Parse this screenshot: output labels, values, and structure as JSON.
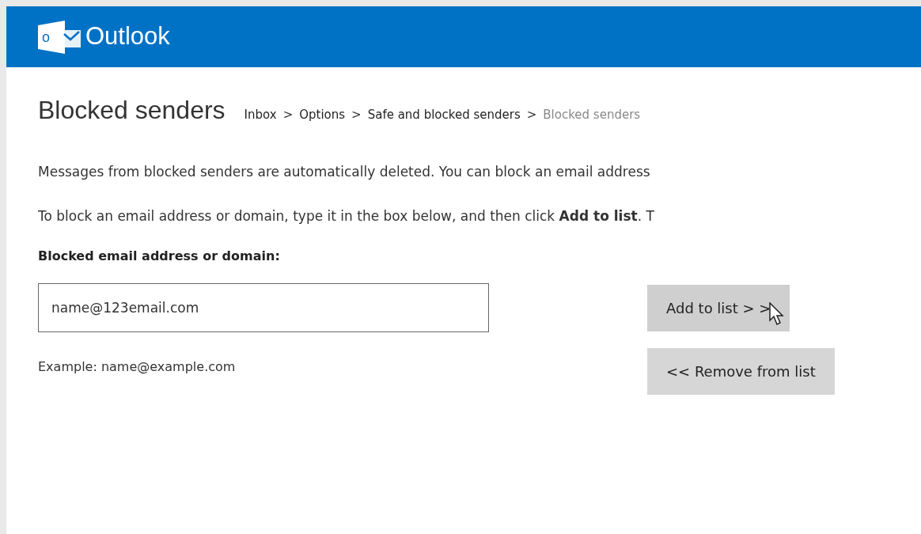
{
  "header": {
    "app_name": "Outlook",
    "logo_letter": "o"
  },
  "page_title": "Blocked senders",
  "breadcrumb": [
    {
      "label": "Inbox",
      "current": false
    },
    {
      "label": "Options",
      "current": false
    },
    {
      "label": "Safe and blocked senders",
      "current": false
    },
    {
      "label": "Blocked senders",
      "current": true
    }
  ],
  "breadcrumb_separator": ">",
  "paragraphs": [
    "Messages from blocked senders are automatically deleted. You can block an email address",
    "To block an email address or domain, type it in the box below, and then click **Add to list**. T"
  ],
  "field": {
    "label": "Blocked email address or domain:",
    "value": "name@123email.com",
    "example": "Example: name@example.com"
  },
  "buttons": [
    {
      "label": "Add to list > >",
      "hovered": true
    },
    {
      "label": "<< Remove from list",
      "hovered": false
    }
  ]
}
